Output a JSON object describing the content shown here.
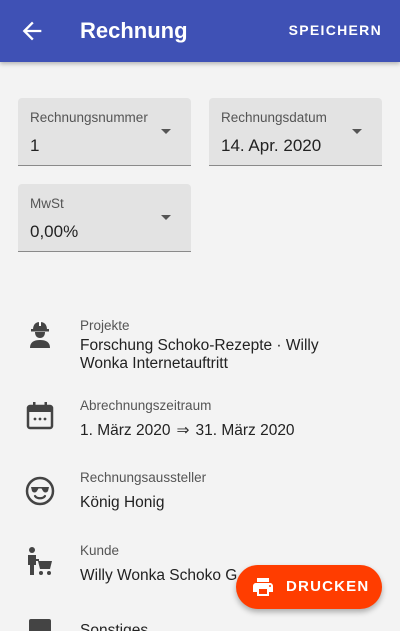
{
  "appbar": {
    "back_icon": "arrow-left-icon",
    "title": "Rechnung",
    "save_label": "SPEICHERN"
  },
  "fields": {
    "nummer": {
      "label": "Rechnungsnummer",
      "value": "1"
    },
    "datum": {
      "label": "Rechnungsdatum",
      "value": "14. Apr. 2020"
    },
    "mwst": {
      "label": "MwSt",
      "value": "0,00%"
    }
  },
  "rows": {
    "projekte": {
      "icon": "worker-icon",
      "label": "Projekte",
      "value": "Forschung Schoko-Rezepte · Willy Wonka Internetauftritt"
    },
    "zeitraum": {
      "icon": "calendar-icon",
      "label": "Abrechnungszeitraum",
      "from": "1. März 2020",
      "to": "31. März 2020"
    },
    "aussteller": {
      "icon": "sunglasses-face-icon",
      "label": "Rechnungsaussteller",
      "value": "König Honig"
    },
    "kunde": {
      "icon": "customer-cart-icon",
      "label": "Kunde",
      "value": "Willy Wonka Schoko G"
    },
    "sonstiges": {
      "icon": "note-icon",
      "label": "Sonstiges"
    }
  },
  "fab": {
    "icon": "printer-icon",
    "label": "DRUCKEN"
  },
  "colors": {
    "primary": "#3f51b5",
    "accent": "#ff3d00",
    "background": "#f3f3f3"
  }
}
